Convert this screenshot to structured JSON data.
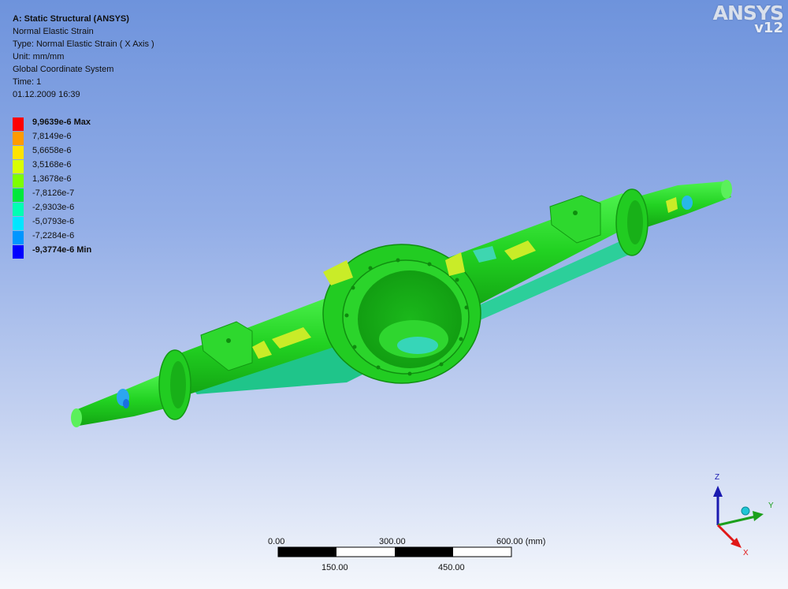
{
  "header": {
    "analysis_title": "A: Static Structural (ANSYS)",
    "result_name": "Normal Elastic Strain",
    "type": "Type: Normal Elastic Strain ( X Axis )",
    "unit": "Unit: mm/mm",
    "coordinate_system": "Global Coordinate System",
    "time": "Time: 1",
    "timestamp": "01.12.2009 16:39"
  },
  "logo": {
    "name": "ANSYS",
    "version": "v12"
  },
  "legend": {
    "entries": [
      {
        "label": "9,9639e-6 Max",
        "color": "#ff0000",
        "bold": true
      },
      {
        "label": "7,8149e-6",
        "color": "#ff9b00",
        "bold": false
      },
      {
        "label": "5,6658e-6",
        "color": "#ffe300",
        "bold": false
      },
      {
        "label": "3,5168e-6",
        "color": "#d9ff00",
        "bold": false
      },
      {
        "label": "1,3678e-6",
        "color": "#7dff00",
        "bold": false
      },
      {
        "label": "-7,8126e-7",
        "color": "#00e83c",
        "bold": false
      },
      {
        "label": "-2,9303e-6",
        "color": "#00ffb3",
        "bold": false
      },
      {
        "label": "-5,0793e-6",
        "color": "#00e6ff",
        "bold": false
      },
      {
        "label": "-7,2284e-6",
        "color": "#0096ff",
        "bold": false
      },
      {
        "label": "-9,3774e-6 Min",
        "color": "#0000ff",
        "bold": true
      }
    ]
  },
  "scale_bar": {
    "top_labels": [
      "0.00",
      "300.00",
      "600.00 (mm)"
    ],
    "bottom_labels": [
      "150.00",
      "450.00"
    ]
  },
  "triad": {
    "x_label": "X",
    "y_label": "Y",
    "z_label": "Z"
  },
  "colors": {
    "background_top": "#6e93dc",
    "background_bottom": "#f4f7fc",
    "model_green": "#1fd81f",
    "model_dark_green": "#12a412",
    "axis_x": "#e01818",
    "axis_y": "#1ca01c",
    "axis_z": "#1a1ab0"
  }
}
